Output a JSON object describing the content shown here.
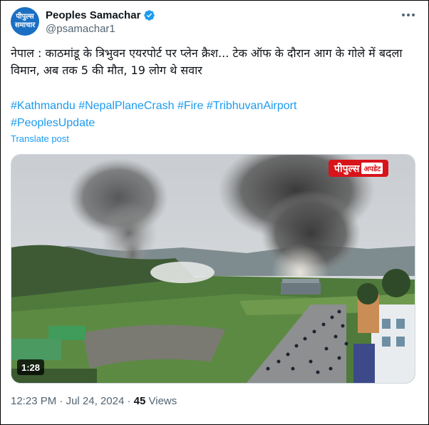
{
  "author": {
    "avatar_line1": "पीपुल्स",
    "avatar_line2": "समाचार",
    "name": "Peoples Samachar",
    "handle": "@psamachar1"
  },
  "tweet": {
    "text": "नेपाल : काठमांडू के त्रिभुवन एयरपोर्ट पर प्लेन क्रैश... टेक ऑफ के दौरान आग के गोले में बदला विमान, अब तक 5 की मौत, 19 लोग थे सवार",
    "hashtags": [
      "#Kathmandu",
      "#NepalPlaneCrash",
      "#Fire",
      "#TribhuvanAirport",
      "#PeoplesUpdate"
    ],
    "translate_label": "Translate post"
  },
  "media": {
    "watermark_main": "पीपुल्स",
    "watermark_sub": "अपडेट",
    "duration": "1:28"
  },
  "footer": {
    "time": "12:23 PM",
    "separator": "·",
    "date": "Jul 24, 2024",
    "views_count": "45",
    "views_label": "Views"
  },
  "colors": {
    "link": "#1d9bf0",
    "verified": "#1d9bf0",
    "watermark": "#d8141b"
  },
  "icons": [
    "verified-badge-icon",
    "more-options-icon"
  ]
}
